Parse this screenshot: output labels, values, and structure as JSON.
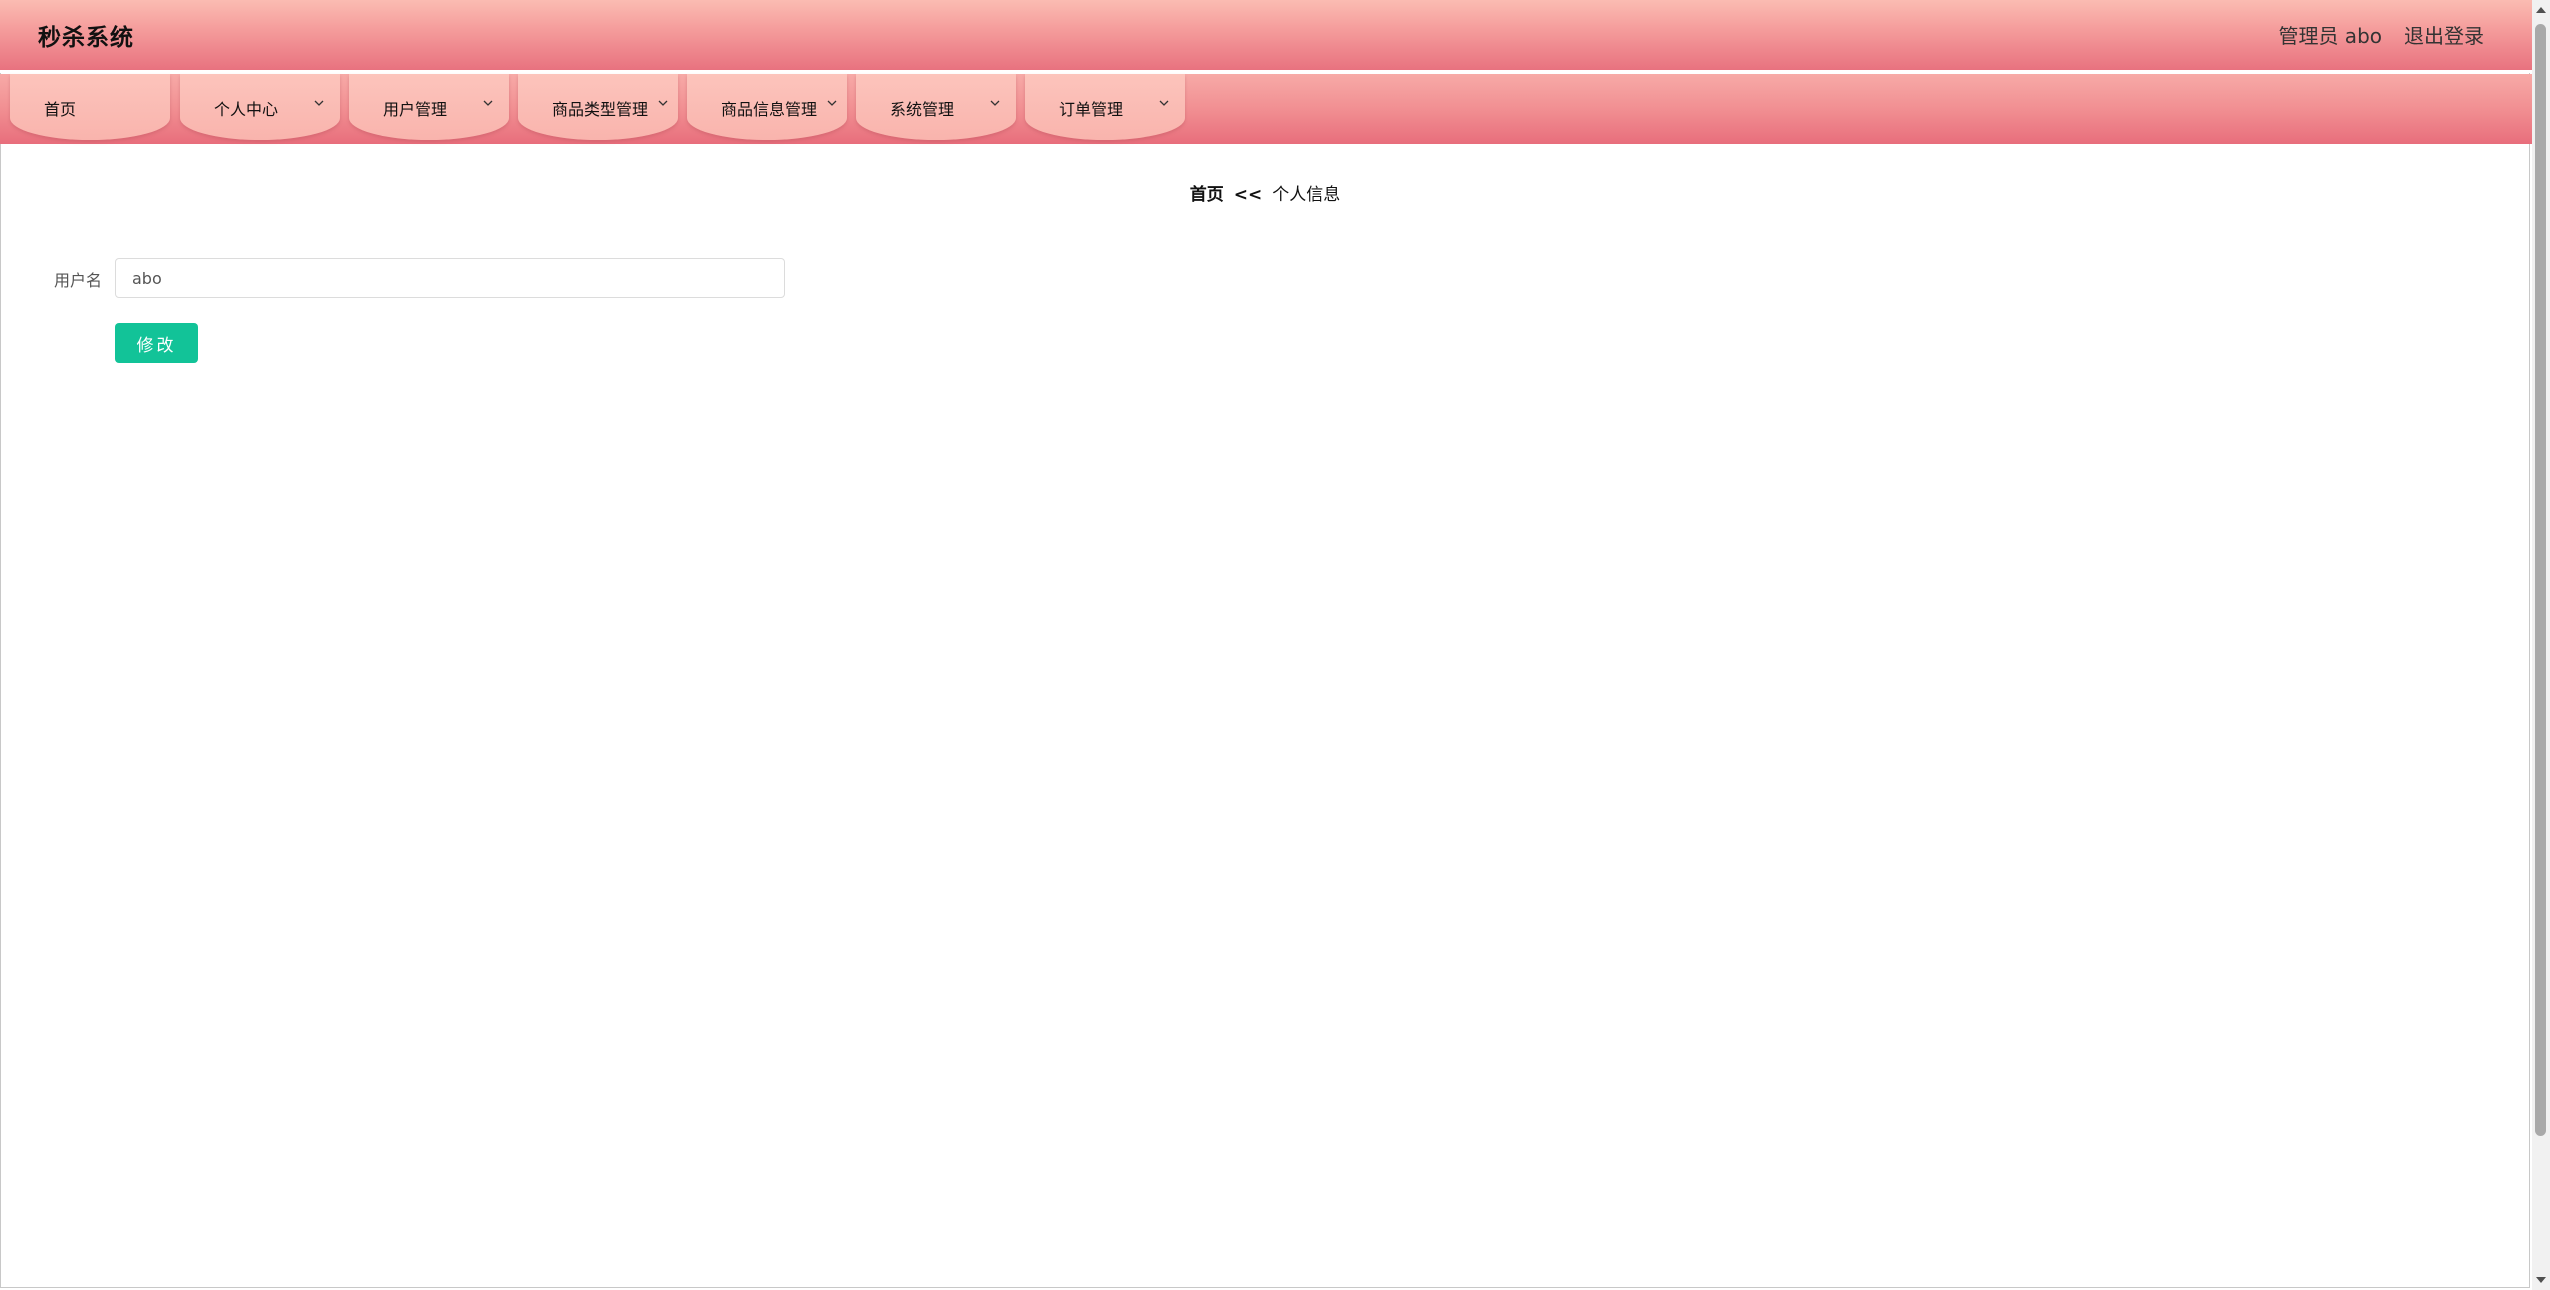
{
  "header": {
    "title": "秒杀系统",
    "user_info": "管理员 abo",
    "logout_label": "退出登录"
  },
  "nav": {
    "items": [
      {
        "label": "首页",
        "has_dropdown": false
      },
      {
        "label": "个人中心",
        "has_dropdown": true
      },
      {
        "label": "用户管理",
        "has_dropdown": true
      },
      {
        "label": "商品类型管理",
        "has_dropdown": true
      },
      {
        "label": "商品信息管理",
        "has_dropdown": true
      },
      {
        "label": "系统管理",
        "has_dropdown": true
      },
      {
        "label": "订单管理",
        "has_dropdown": true
      }
    ]
  },
  "breadcrumb": {
    "home": "首页",
    "separator": "<<",
    "current": "个人信息"
  },
  "form": {
    "username_label": "用户名",
    "username_value": "abo",
    "submit_label": "修改"
  },
  "colors": {
    "header_gradient": [
      "#fbbcb2",
      "#e8727f"
    ],
    "nav_tab": "#f9b4ad",
    "submit_button": "#12c398"
  },
  "icons": {
    "dropdown": "chevron-down-icon"
  }
}
